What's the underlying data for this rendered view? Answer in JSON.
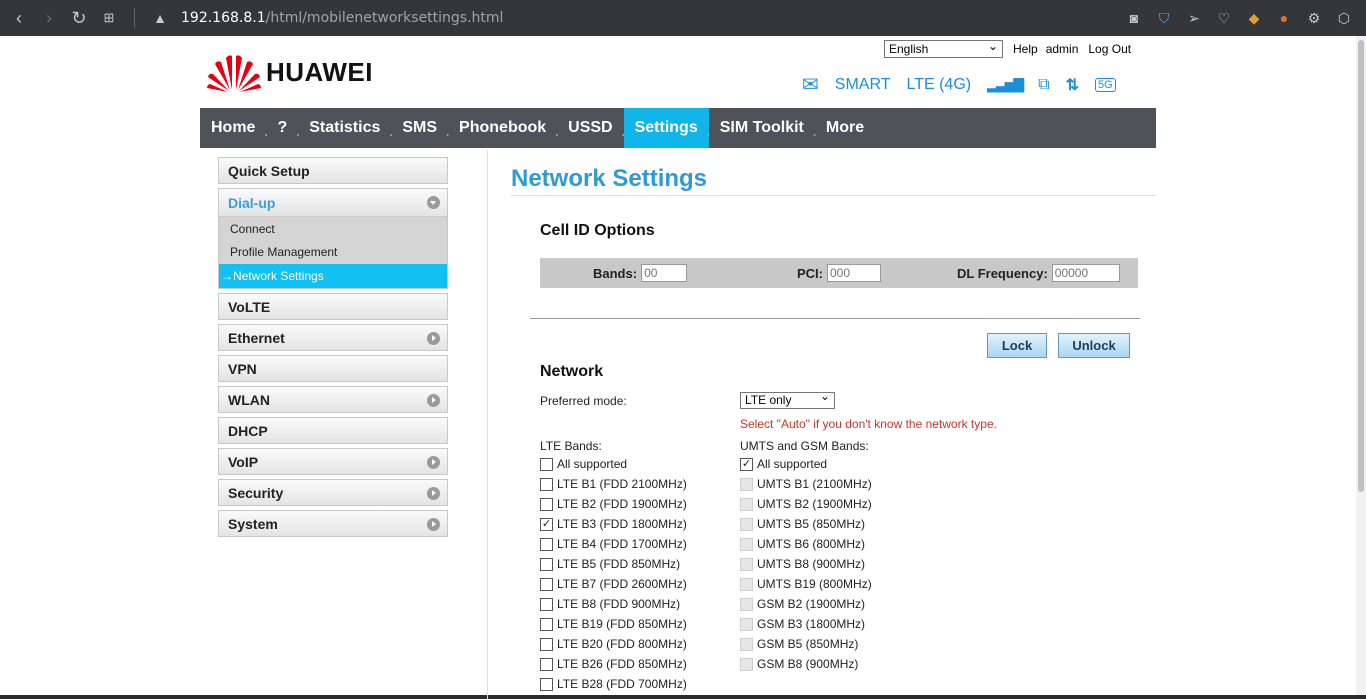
{
  "browser": {
    "url_host": "192.168.8.1",
    "url_path": "/html/mobilenetworksettings.html"
  },
  "header": {
    "language": "English",
    "help": "Help",
    "user": "admin",
    "logout": "Log Out",
    "brand": "HUAWEI",
    "operator": "SMART",
    "network_type": "LTE (4G)"
  },
  "nav": [
    "Home",
    "?",
    "Statistics",
    "SMS",
    "Phonebook",
    "USSD",
    "Settings",
    "SIM Toolkit",
    "More"
  ],
  "nav_active": "Settings",
  "sidebar": {
    "quick_setup": "Quick Setup",
    "dialup": "Dial-up",
    "dialup_items": [
      "Connect",
      "Profile Management",
      "→Network Settings"
    ],
    "items": [
      "VoLTE",
      "Ethernet",
      "VPN",
      "WLAN",
      "DHCP",
      "VoIP",
      "Security",
      "System"
    ]
  },
  "main": {
    "title": "Network Settings",
    "cell_id_title": "Cell ID Options",
    "bands_label": "Bands:",
    "bands_placeholder": "00",
    "pci_label": "PCI:",
    "pci_placeholder": "000",
    "dl_label": "DL Frequency:",
    "dl_placeholder": "00000",
    "lock": "Lock",
    "unlock": "Unlock",
    "network_title": "Network",
    "preferred_mode_label": "Preferred mode:",
    "preferred_mode_value": "LTE only",
    "hint": "Select \"Auto\" if you don't know the network type.",
    "lte_bands_label": "LTE Bands:",
    "umts_bands_label": "UMTS and GSM Bands:"
  },
  "lte_bands": [
    {
      "label": "All supported",
      "checked": false
    },
    {
      "label": "LTE B1 (FDD 2100MHz)",
      "checked": false
    },
    {
      "label": "LTE B2 (FDD 1900MHz)",
      "checked": false
    },
    {
      "label": "LTE B3 (FDD 1800MHz)",
      "checked": true
    },
    {
      "label": "LTE B4 (FDD 1700MHz)",
      "checked": false
    },
    {
      "label": "LTE B5 (FDD 850MHz)",
      "checked": false
    },
    {
      "label": "LTE B7 (FDD 2600MHz)",
      "checked": false
    },
    {
      "label": "LTE B8 (FDD 900MHz)",
      "checked": false
    },
    {
      "label": "LTE B19 (FDD 850MHz)",
      "checked": false
    },
    {
      "label": "LTE B20 (FDD 800MHz)",
      "checked": false
    },
    {
      "label": "LTE B26 (FDD 850MHz)",
      "checked": false
    },
    {
      "label": "LTE B28 (FDD 700MHz)",
      "checked": false
    }
  ],
  "umts_bands": [
    {
      "label": "All supported",
      "checked": true,
      "disabled": false
    },
    {
      "label": "UMTS B1 (2100MHz)",
      "checked": false,
      "disabled": true
    },
    {
      "label": "UMTS B2 (1900MHz)",
      "checked": false,
      "disabled": true
    },
    {
      "label": "UMTS B5 (850MHz)",
      "checked": false,
      "disabled": true
    },
    {
      "label": "UMTS B6 (800MHz)",
      "checked": false,
      "disabled": true
    },
    {
      "label": "UMTS B8 (900MHz)",
      "checked": false,
      "disabled": true
    },
    {
      "label": "UMTS B19 (800MHz)",
      "checked": false,
      "disabled": true
    },
    {
      "label": "GSM B2 (1900MHz)",
      "checked": false,
      "disabled": true
    },
    {
      "label": "GSM B3 (1800MHz)",
      "checked": false,
      "disabled": true
    },
    {
      "label": "GSM B5 (850MHz)",
      "checked": false,
      "disabled": true
    },
    {
      "label": "GSM B8 (900MHz)",
      "checked": false,
      "disabled": true
    }
  ]
}
